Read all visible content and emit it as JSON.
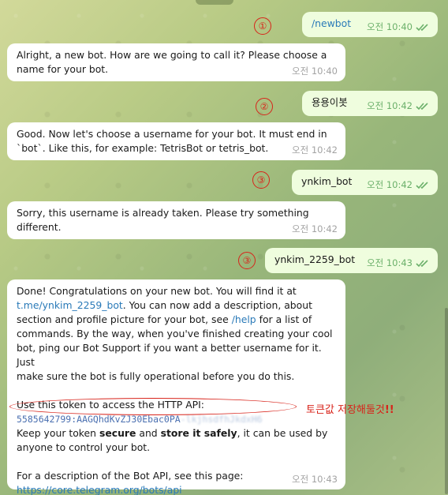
{
  "messages": [
    {
      "id": "m1",
      "text": "/newbot",
      "time": "오전 10:40",
      "marker": "①"
    },
    {
      "id": "m2",
      "text": "Alright, a new bot. How are we going to call it? Please choose a name for your bot.",
      "line1": "Alright, a new bot. How are we going to call it? Please choose a",
      "line2": "name for your bot.",
      "time": "오전 10:40"
    },
    {
      "id": "m3",
      "text": "용용이봇",
      "time": "오전 10:42",
      "marker": "②"
    },
    {
      "id": "m4",
      "line1": "Good. Now let's choose a username for your bot. It must end in",
      "line2": "`bot`. Like this, for example: TetrisBot or tetris_bot.",
      "time": "오전 10:42"
    },
    {
      "id": "m5",
      "text": "ynkim_bot",
      "time": "오전 10:42",
      "marker": "③"
    },
    {
      "id": "m6",
      "line1": "Sorry, this username is already taken. Please try something",
      "line2": "different.",
      "time": "오전 10:42"
    },
    {
      "id": "m7",
      "text": "ynkim_2259_bot",
      "time": "오전 10:43",
      "marker": "③"
    },
    {
      "id": "m8",
      "p1_line1": "Done! Congratulations on your new bot. You will find it at",
      "p1_link": "t.me/ynkim_2259_bot",
      "p1_line2_rest": ". You can now add a description, about",
      "p1_line3_pre": "section and profile picture for your bot, see ",
      "p1_help": "/help",
      "p1_line3_post": " for a list of",
      "p1_line4": "commands. By the way, when you've finished creating your cool",
      "p1_line5": "bot, ping our Bot Support if you want a better username for it. Just",
      "p1_line6": "make sure the bot is fully operational before you do this.",
      "token_label": "Use this token to access the HTTP API:",
      "token_visible": "5585642799:AAGQhdKvZJ30Ebac0PA",
      "token_hidden": "-lkjhsdfhJkdxH6",
      "keep_pre": "Keep your token ",
      "keep_secure": "secure",
      "keep_and": " and ",
      "keep_store": "store it safely",
      "keep_post": ", it can be used by",
      "keep_line2": "anyone to control your bot.",
      "api_line": "For a description of the Bot API, see this page:",
      "api_link": "https://core.telegram.org/bots/api",
      "time": "오전 10:43"
    }
  ],
  "annotation": {
    "note": "토큰값 저장해둘것",
    "emph": "!!"
  },
  "colors": {
    "accent_red": "#d8231a",
    "link": "#2a7ab8",
    "out_bubble": "#effdde",
    "tick_green": "#6bb06a"
  }
}
